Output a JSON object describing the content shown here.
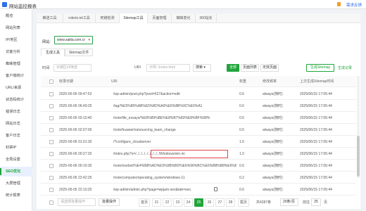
{
  "app": {
    "title": "网站监控报表",
    "feedback": "需求反馈"
  },
  "sidebar": {
    "items": [
      {
        "label": "概览",
        "active": false
      },
      {
        "label": "网站列表",
        "active": false
      },
      {
        "label": "IP/地区",
        "active": false
      },
      {
        "label": "访客分析",
        "active": false
      },
      {
        "label": "蜘蛛管理",
        "active": false
      },
      {
        "label": "客户端统计",
        "active": false
      },
      {
        "label": "URL/来源",
        "active": false
      },
      {
        "label": "状态码统计",
        "active": false
      },
      {
        "label": "错误日志",
        "active": false
      },
      {
        "label": "网站日志",
        "active": false
      },
      {
        "label": "客户日志",
        "active": false
      },
      {
        "label": "封禁IP",
        "active": false
      },
      {
        "label": "全局设置",
        "active": false
      },
      {
        "label": "SEO优化",
        "active": true
      },
      {
        "label": "大屏管理",
        "active": false
      },
      {
        "label": "统计报表",
        "active": false
      }
    ]
  },
  "tabs": [
    "推送工具",
    "robots.txt工具",
    "死链检测",
    "Sitemap工具",
    "页面管理",
    "蜘蛛变化",
    "360站长"
  ],
  "active_tab": 3,
  "site": {
    "label": "网站:",
    "value": "www.saiita.com.cr"
  },
  "subtabs": [
    "生成工具",
    "Sitemap文件"
  ],
  "filter": {
    "time_label": "时间",
    "time_placeholder": "日期区间筛选",
    "uri_label": "URI",
    "uri_placeholder": "示例: /index.html",
    "search_label": "搜索",
    "all_btn": "全部",
    "has_page_btn": "页面列表",
    "no_page_btn": "无效页面",
    "generate_btn": "生成Sitemap",
    "generate_log": "生成记录"
  },
  "table": {
    "headers": [
      "收录日期",
      "URI",
      "权重",
      "修改频率",
      "上次生成Sitemap时间"
    ],
    "rows": [
      {
        "date": "2025-06-06 09:47:52",
        "uri": "/wp-admin/post.php?post=627&action=edit",
        "weight": "0.6",
        "freq": "always(随时)",
        "last": "2025/06/15 17:05:44"
      },
      {
        "date": "2025-06-06 06:49:25",
        "uri": "/tag/%E5%85%AB%E5%8D%A6%E6%8B%9C%E6%A1",
        "weight": "0.6",
        "freq": "always(随时)",
        "last": "2025/06/15 17:05:44"
      },
      {
        "date": "2025-06-06 03:10:40",
        "uri": "/note/life_essays/%E8%89%BE%E8%B7%83%E8%BF%98%",
        "weight": "0.6",
        "freq": "always(随时)",
        "last": "2025/06/15 17:05:44"
      },
      {
        "date": "2025-06-06 02:07:00",
        "uri": "/note/huawei/outsourcing_team_change",
        "weight": "0.6",
        "freq": "always(随时)",
        "last": "2025/06/15 17:05:44"
      },
      {
        "date": "2025-06-06 01:01:30",
        "uri": "/?configure_cloudserver",
        "weight": "1.0",
        "freq": "always(随时)",
        "last": "2025/06/15 17:05:44"
      },
      {
        "date": "2025-06-06 00:27:20",
        "uri": "/index.php?s=/../../../../../../../../Windows/win.ini",
        "weight": "1.0",
        "freq": "always(随时)",
        "last": "2025/06/15 17:05:44",
        "highlight": true
      },
      {
        "date": "2025-06-06 00:10:30",
        "uri": "/note/noebot/%E4%B8%AD%E5%9B%BD%E6%96%BC%E6%B8%B8%E6%88%8F",
        "weight": "0.6",
        "freq": "always(随时)",
        "last": "2025/06/15 17:05:44"
      },
      {
        "date": "2025-06-05 22:42:25",
        "uri": "/note/computer/operating_system/windows-11",
        "weight": "0.2",
        "freq": "always(随时)",
        "last": "2025/06/15 17:05:44"
      },
      {
        "date": "2025-06-05 22:10:20",
        "uri": "/wp-admin/admin.php?page=wpjam-seo&tab=seo",
        "weight": "0.6",
        "freq": "always(随时)",
        "last": "2025/06/15 17:05:44"
      }
    ]
  },
  "footer": {
    "batch_placeholder": "请选择批量操作",
    "batch_btn": "批量操作",
    "first": "首页",
    "pages": [
      "21",
      "22",
      "23",
      "24",
      "25",
      "26",
      "27",
      "28"
    ],
    "active_page": "25",
    "last": "尾页",
    "total": "共4287条",
    "per_page": "20条/页",
    "goto_label": "前往",
    "goto_value": "25",
    "page_unit": "页"
  },
  "colors": {
    "accent": "#20a53a",
    "highlight_border": "#e04646",
    "primary": "#2f6eeb"
  }
}
